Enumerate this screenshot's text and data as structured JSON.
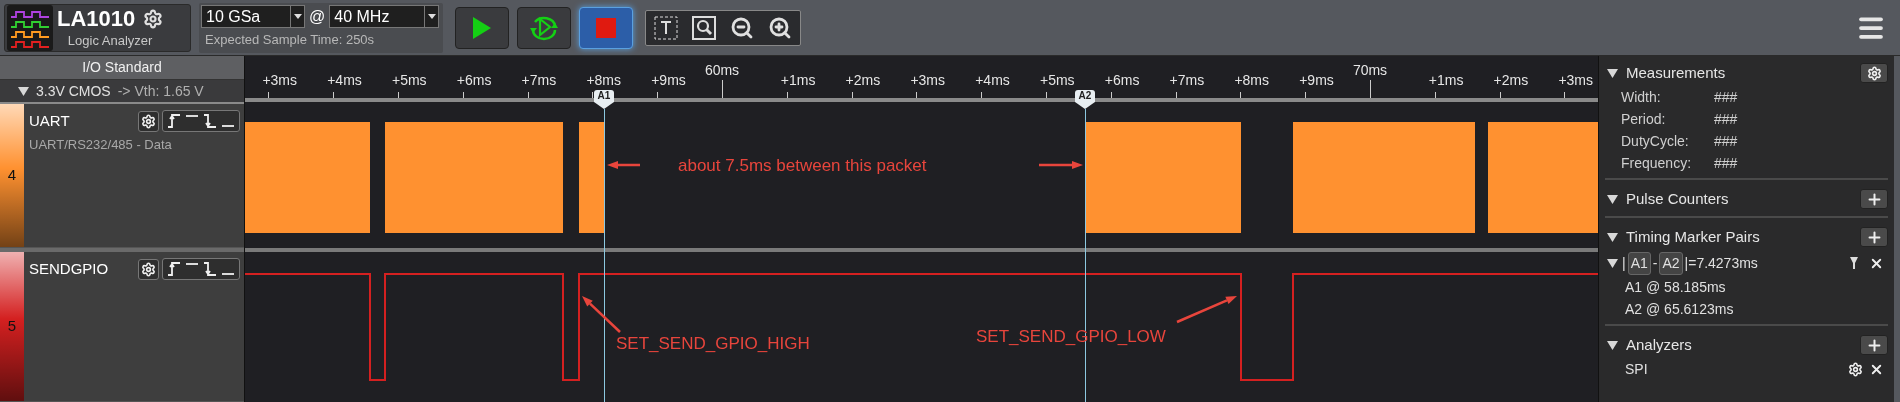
{
  "toolbar": {
    "device": "LA1010",
    "subtitle": "Logic Analyzer",
    "sample_rate": "10 GSa",
    "at": "@",
    "frequency": "40 MHz",
    "expected_time": "Expected Sample Time: 250s",
    "running": true
  },
  "io_standard": {
    "title": "I/O Standard",
    "expanded": true,
    "value": "3.3V CMOS",
    "threshold": "-> Vth: 1.65 V"
  },
  "ruler": [
    {
      "label": "+3ms",
      "kind": "minor"
    },
    {
      "label": "+4ms",
      "kind": "minor"
    },
    {
      "label": "+5ms",
      "kind": "minor"
    },
    {
      "label": "+6ms",
      "kind": "minor"
    },
    {
      "label": "+7ms",
      "kind": "minor"
    },
    {
      "label": "+8ms",
      "kind": "minor"
    },
    {
      "label": "+9ms",
      "kind": "minor"
    },
    {
      "label": "60ms",
      "kind": "major"
    },
    {
      "label": "+1ms",
      "kind": "minor"
    },
    {
      "label": "+2ms",
      "kind": "minor"
    },
    {
      "label": "+3ms",
      "kind": "minor"
    },
    {
      "label": "+4ms",
      "kind": "minor"
    },
    {
      "label": "+5ms",
      "kind": "minor"
    },
    {
      "label": "+6ms",
      "kind": "minor"
    },
    {
      "label": "+7ms",
      "kind": "minor"
    },
    {
      "label": "+8ms",
      "kind": "minor"
    },
    {
      "label": "+9ms",
      "kind": "minor"
    },
    {
      "label": "70ms",
      "kind": "major"
    },
    {
      "label": "+1ms",
      "kind": "minor"
    },
    {
      "label": "+2ms",
      "kind": "minor"
    },
    {
      "label": "+3ms",
      "kind": "minor"
    }
  ],
  "cursors": [
    {
      "label": "A1"
    },
    {
      "label": "A2"
    }
  ],
  "channels": [
    {
      "number": "4",
      "name": "UART",
      "subtitle": "UART/RS232/485 - Data",
      "color": "#ff9130",
      "kind": "bus"
    },
    {
      "number": "5",
      "name": "SENDGPIO",
      "color": "#d42020",
      "kind": "digital"
    }
  ],
  "annotations": [
    {
      "text": "about 7.5ms between this packet"
    },
    {
      "text": "SET_SEND_GPIO_HIGH"
    },
    {
      "text": "SET_SEND_GPIO_LOW"
    }
  ],
  "panel": {
    "measurements": {
      "title": "Measurements",
      "expanded": true,
      "rows": [
        {
          "label": "Width:",
          "value": "###"
        },
        {
          "label": "Period:",
          "value": "###"
        },
        {
          "label": "DutyCycle:",
          "value": "###"
        },
        {
          "label": "Frequency:",
          "value": "###"
        }
      ]
    },
    "pulse_counters": {
      "title": "Pulse Counters",
      "expanded": true
    },
    "timing": {
      "title": "Timing Marker Pairs",
      "expanded": true,
      "pairs": [
        {
          "expanded": true,
          "bar": "|",
          "a": "A1",
          "separator": "-",
          "b": "A2",
          "result": "|=7.4273ms",
          "lines": [
            "A1 @ 58.185ms",
            "A2 @ 65.6123ms"
          ]
        }
      ]
    },
    "analyzers": {
      "title": "Analyzers",
      "expanded": true,
      "items": [
        {
          "name": "SPI"
        }
      ]
    }
  }
}
